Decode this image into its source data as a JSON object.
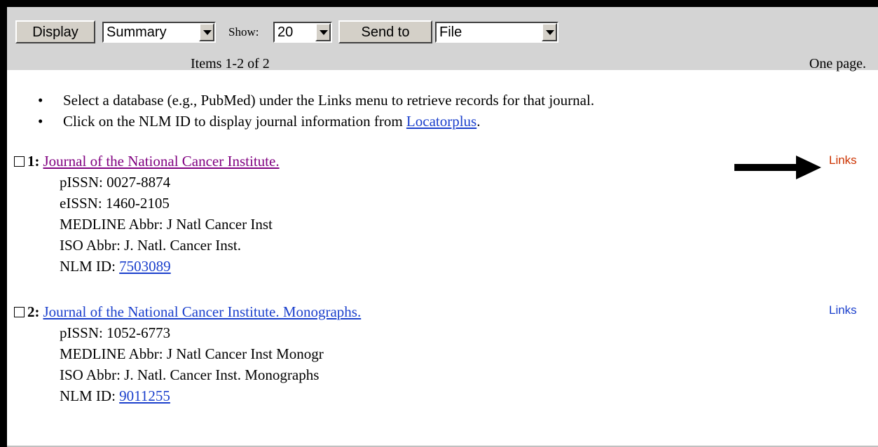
{
  "toolbar": {
    "display_button": "Display",
    "format_select": "Summary",
    "show_label": "Show:",
    "show_select": "20",
    "send_button": "Send to",
    "send_select": "File",
    "items_count": "Items 1-2 of 2",
    "pages": "One page."
  },
  "instructions": {
    "line1": "Select a database (e.g., PubMed) under the Links menu to retrieve records for that journal.",
    "line2_before": "Click on the NLM ID to display journal information from ",
    "line2_link": "Locatorplus",
    "line2_after": "."
  },
  "records": [
    {
      "number": "1:",
      "title": "Journal of the National Cancer Institute.",
      "pissn": "pISSN: 0027-8874",
      "eissn": "eISSN: 1460-2105",
      "medline_abbr": "MEDLINE Abbr: J Natl Cancer Inst",
      "iso_abbr": "ISO Abbr: J. Natl. Cancer Inst.",
      "nlm_label": "NLM ID: ",
      "nlm_id": "7503089",
      "links": "Links"
    },
    {
      "number": "2:",
      "title": "Journal of the National Cancer Institute. Monographs.",
      "pissn": "pISSN: 1052-6773",
      "medline_abbr": "MEDLINE Abbr: J Natl Cancer Inst Monogr",
      "iso_abbr": "ISO Abbr: J. Natl. Cancer Inst. Monographs",
      "nlm_label": "NLM ID: ",
      "nlm_id": "9011255",
      "links": "Links"
    }
  ],
  "colors": {
    "link": "#1a3fcc",
    "visited_link": "#800080",
    "links_highlight": "#cc3300",
    "toolbar_bg": "#d4d4d4"
  },
  "icons": {
    "annotation_arrow": "right-arrow-icon",
    "dropdown": "chevron-down-icon"
  }
}
